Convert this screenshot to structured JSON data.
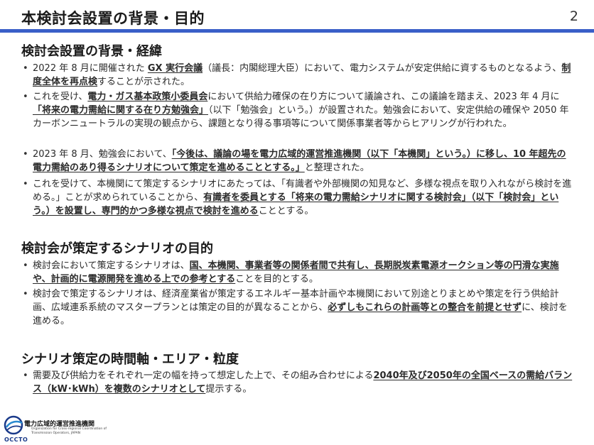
{
  "header": {
    "title": "本検討会設置の背景・目的",
    "page_number": "2"
  },
  "sections": [
    {
      "heading": "検討会設置の背景・経緯",
      "bullets": [
        [
          {
            "t": "2022 年 8 月に開催された "
          },
          {
            "t": "GX 実行会議",
            "em": true
          },
          {
            "t": "（議長：内閣総理大臣）において、電力システムが安定供給に資するものとなるよう、"
          },
          {
            "t": "制度全体を再点検",
            "em": true
          },
          {
            "t": "することが示された。"
          }
        ],
        [
          {
            "t": "これを受け、"
          },
          {
            "t": "電力・ガス基本政策小委員会",
            "em": true
          },
          {
            "t": "において供給力確保の在り方について議論され、この議論を踏まえ、2023 年 4 月に"
          },
          {
            "t": "「将来の電力需給に関する在り方勉強会」",
            "em": true
          },
          {
            "t": "（以下「勉強会」という。）が設置された。勉強会において、安定供給の確保や 2050 年カーボンニュートラルの実現の観点から、課題となり得る事項等について関係事業者等からヒアリングが行われた。"
          }
        ],
        [
          {
            "t": "2023 年 8 月、勉強会において、"
          },
          {
            "t": "「今後は、議論の場を電力広域的運営推進機関（以下「本機関」という。）に移し、10 年超先の電力需給のあり得るシナリオについて策定を進めることとする。」",
            "em": true
          },
          {
            "t": "と整理された。"
          }
        ],
        [
          {
            "t": "これを受けて、本機関にて策定するシナリオにあたっては、「有識者や外部機関の知見など、多様な視点を取り入れながら検討を進める。」ことが求められていることから、"
          },
          {
            "t": "有識者を委員とする「将来の電力需給シナリオに関する検討会」（以下「検討会」という。）を設置し、専門的かつ多様な視点で検討を進める",
            "em": true
          },
          {
            "t": "こととする。"
          }
        ]
      ]
    },
    {
      "heading": "検討会が策定するシナリオの目的",
      "bullets": [
        [
          {
            "t": "検討会において策定するシナリオは、"
          },
          {
            "t": "国、本機関、事業者等の関係者間で共有し、長期脱炭素電源オークション等の円滑な実施や、計画的に電源開発を進める上での参考とする",
            "em": true
          },
          {
            "t": "ことを目的とする。"
          }
        ],
        [
          {
            "t": "検討会で策定するシナリオは、経済産業省が策定するエネルギー基本計画や本機関において別途とりまとめや策定を行う供給計画、広域連系系統のマスタープランとは策定の目的が異なることから、"
          },
          {
            "t": "必ずしもこれらの計画等との整合を前提とせず",
            "em": true
          },
          {
            "t": "に、検討を進める。"
          }
        ]
      ]
    },
    {
      "heading": "シナリオ策定の時間軸・エリア・粒度",
      "bullets": [
        [
          {
            "t": "需要及び供給力をそれぞれ一定の幅を持って想定した上で、その組み合わせによる"
          },
          {
            "t": "2040年及び2050年の全国ベースの需給バランス（kW･kWh）を複数のシナリオとして",
            "em": true
          },
          {
            "t": "提示する。"
          }
        ]
      ]
    }
  ],
  "footer": {
    "org_name_ja": "電力広域的運営推進機関",
    "org_name_en": "Organization for Cross-regional Coordination of Transmission Operators, JAPAN",
    "logo_text": "OCCTO",
    "logo_icon": "occto-globe-logo-icon"
  },
  "colors": {
    "title_rule": "#3a5fc8",
    "logo_blue": "#1a3a8a"
  }
}
